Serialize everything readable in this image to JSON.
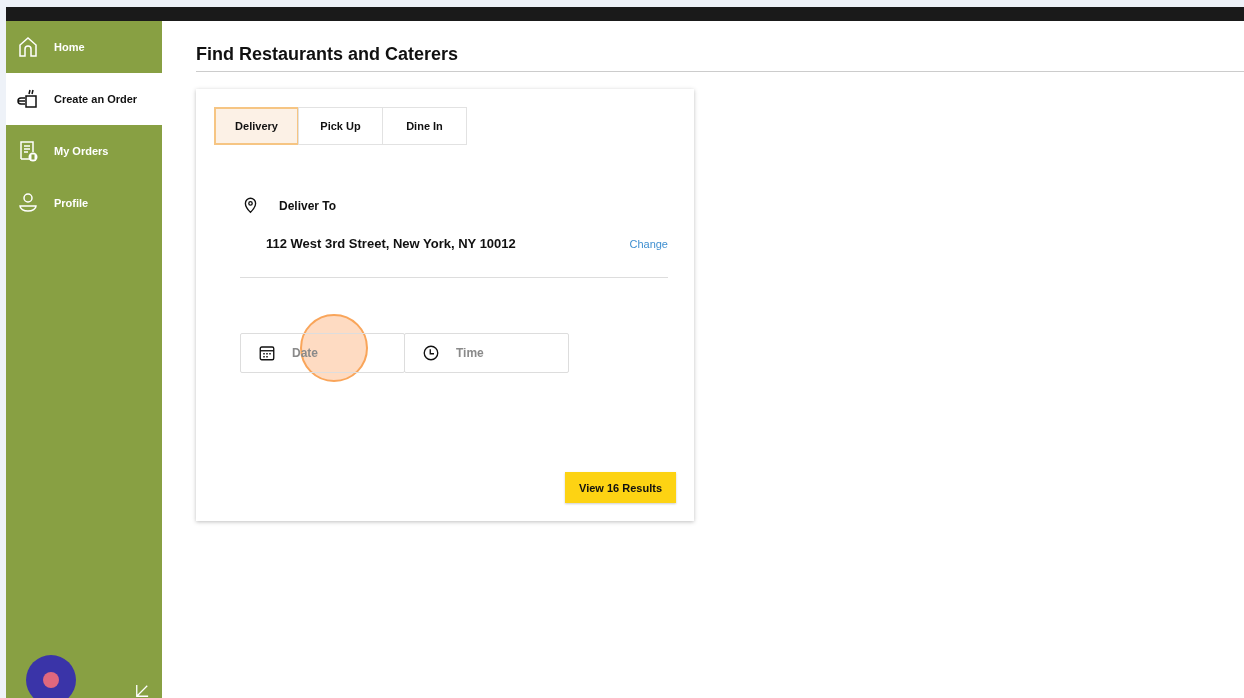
{
  "sidebar": {
    "items": [
      {
        "label": "Home",
        "selected": false
      },
      {
        "label": "Create an Order",
        "selected": true
      },
      {
        "label": "My Orders",
        "selected": false
      },
      {
        "label": "Profile",
        "selected": false
      }
    ]
  },
  "page": {
    "title": "Find Restaurants and Caterers"
  },
  "order_types": [
    {
      "label": "Delivery",
      "selected": true
    },
    {
      "label": "Pick Up",
      "selected": false
    },
    {
      "label": "Dine In",
      "selected": false
    }
  ],
  "delivery": {
    "label": "Deliver To",
    "address": "112 West 3rd Street, New York, NY 10012",
    "change_link": "Change"
  },
  "fields": [
    {
      "kind": "date",
      "placeholder": "Date"
    },
    {
      "kind": "time",
      "placeholder": "Time"
    }
  ],
  "results_button": "View 16 Results"
}
